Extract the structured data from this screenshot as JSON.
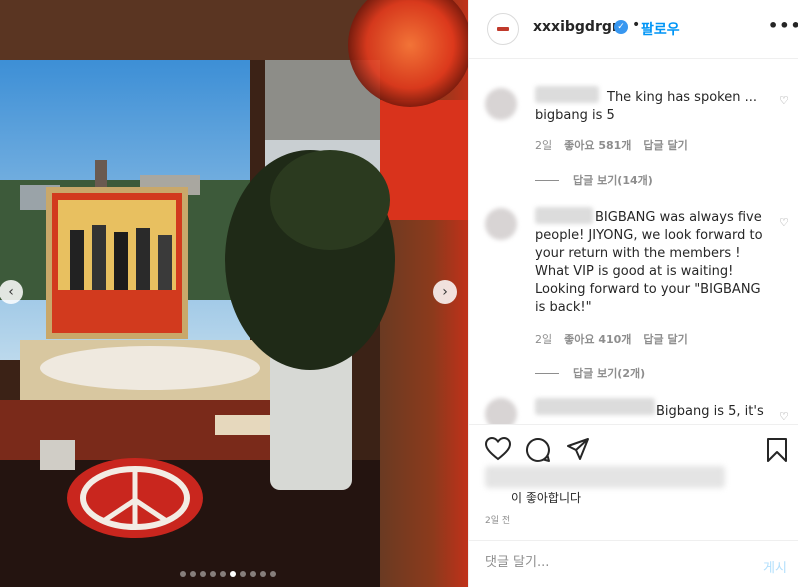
{
  "header": {
    "username": "xxxibgdrgn",
    "verified_glyph": "✓",
    "separator": "•",
    "follow_label": "팔로우",
    "more_label": "•••"
  },
  "carousel": {
    "prev_glyph": "‹",
    "next_glyph": "›",
    "total_slides": 10,
    "active_index": 5
  },
  "comments": [
    {
      "text": "The king has spoken ... bigbang is 5",
      "age": "2일",
      "likes": "좋아요 581개",
      "reply": "답글 달기",
      "view_replies": "답글 보기(14개)"
    },
    {
      "text": "BIGBANG was always five people! JIYONG, we look forward to your return with the members ! What VIP is good at is waiting! Looking forward to your \"BIGBANG is back!\"",
      "age": "2일",
      "likes": "좋아요 410개",
      "reply": "답글 달기",
      "view_replies": "답글 보기(2개)"
    },
    {
      "text": "Bigbang is 5, it's"
    }
  ],
  "likes_text": "이 좋아합니다",
  "post_time": "2일 전",
  "composer": {
    "placeholder": "댓글 달기...",
    "post_label": "게시"
  },
  "colors": {
    "link_blue": "#0095f6",
    "verified_blue": "#3897f0",
    "muted": "#8e8e8e"
  }
}
